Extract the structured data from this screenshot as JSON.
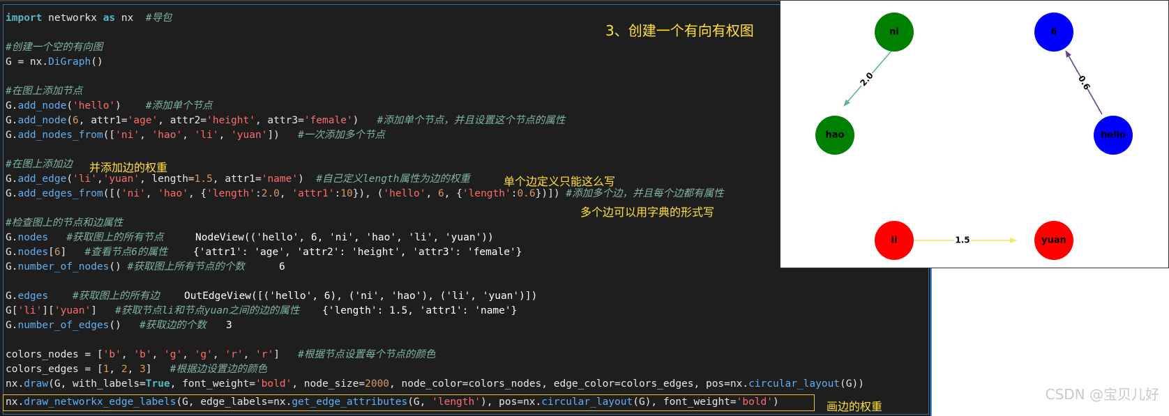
{
  "title_note": "3、创建一个有向有权图",
  "notes": {
    "add_edge_weight": "并添加边的权重",
    "single_edge": "单个边定义只能这么写",
    "multi_edge": "多个边可以用字典的形式写",
    "draw_weight": "画边的权重"
  },
  "code": {
    "l1": [
      "import",
      " networkx ",
      "as",
      " nx  ",
      "#导包"
    ],
    "l3": "#创建一个空的有向图",
    "l4": [
      "G = nx.",
      "DiGraph",
      "()"
    ],
    "l6": "#在图上添加节点",
    "l7": [
      "G.",
      "add_node",
      "(",
      "'hello'",
      ")    ",
      "#添加单个节点"
    ],
    "l8": [
      "G.",
      "add_node",
      "(",
      "6",
      ", attr1=",
      "'age'",
      ", attr2=",
      "'height'",
      ", attr3=",
      "'female'",
      ")   ",
      "#添加单个节点，并且设置这个节点的属性"
    ],
    "l9": [
      "G.",
      "add_nodes_from",
      "([",
      "'ni'",
      ", ",
      "'hao'",
      ", ",
      "'li'",
      ", ",
      "'yuan'",
      "])   ",
      "#一次添加多个节点"
    ],
    "l11": "#在图上添加边",
    "l12": [
      "G.",
      "add_edge",
      "(",
      "'li'",
      ",",
      "'yuan'",
      ", length=",
      "1.5",
      ", attr1=",
      "'name'",
      ")  ",
      "#自己定义length属性为边的权重"
    ],
    "l13": [
      "G.",
      "add_edges_from",
      "([(",
      "'ni'",
      ", ",
      "'hao'",
      ", {",
      "'length'",
      ":",
      "2.0",
      ", ",
      "'attr1'",
      ":",
      "10",
      "}), (",
      "'hello'",
      ", ",
      "6",
      ", {",
      "'length'",
      ":",
      "0.6",
      "})]) ",
      "#添加多个边，并且每个边都有属性"
    ],
    "l15": "#检查图上的节点和边属性",
    "l16": [
      "G.",
      "nodes",
      "   ",
      "#获取图上的所有节点"
    ],
    "l16_out": "NodeView(('hello', 6, 'ni', 'hao', 'li', 'yuan'))",
    "l17": [
      "G.",
      "nodes",
      "[",
      "6",
      "]   ",
      "#查看节点6的属性"
    ],
    "l17_out": "{'attr1': 'age', 'attr2': 'height', 'attr3': 'female'}",
    "l18": [
      "G.",
      "number_of_nodes",
      "() ",
      "#获取图上所有节点的个数"
    ],
    "l18_out": "6",
    "l20": [
      "G.",
      "edges",
      "    ",
      "#获取图上的所有边"
    ],
    "l20_out": "OutEdgeView([('hello', 6), ('ni', 'hao'), ('li', 'yuan')])",
    "l21": [
      "G[",
      "'li'",
      "][",
      "'yuan'",
      "]   ",
      "#获取节点li和节点yuan之间的边的属性"
    ],
    "l21_out": "{'length': 1.5, 'attr1': 'name'}",
    "l22": [
      "G.",
      "number_of_edges",
      "()   ",
      "#获取边的个数"
    ],
    "l22_out": "3",
    "l24": [
      "colors_nodes = [",
      "'b'",
      ", ",
      "'b'",
      ", ",
      "'g'",
      ", ",
      "'g'",
      ", ",
      "'r'",
      ", ",
      "'r'",
      "]   ",
      "#根据节点设置每个节点的颜色"
    ],
    "l25": [
      "colors_edges = [",
      "1",
      ", ",
      "2",
      ", ",
      "3",
      "]   ",
      "#根据边设置边的颜色"
    ],
    "l26": [
      "nx.",
      "draw",
      "(G, with_labels=",
      "True",
      ", font_weight=",
      "'bold'",
      ", node_size=",
      "2000",
      ", node_color=colors_nodes, edge_color=colors_edges, pos=nx.",
      "circular_layout",
      "(G))"
    ],
    "l27": [
      "nx.",
      "draw_networkx_edge_labels",
      "(G, edge_labels=nx.",
      "get_edge_attributes",
      "(G, ",
      "'length'",
      "), pos=nx.",
      "circular_layout",
      "(G), font_weight=",
      "'bold'",
      ")"
    ]
  },
  "graph": {
    "nodes": [
      {
        "label": "ni",
        "color": "#008000"
      },
      {
        "label": "6",
        "color": "#0000ff"
      },
      {
        "label": "hao",
        "color": "#008000"
      },
      {
        "label": "hello",
        "color": "#0000ff"
      },
      {
        "label": "li",
        "color": "#ff0000"
      },
      {
        "label": "yuan",
        "color": "#ff0000"
      }
    ],
    "edges": [
      {
        "from": "ni",
        "to": "hao",
        "label": "2.0",
        "color": "#5fb0a8"
      },
      {
        "from": "hello",
        "to": "6",
        "label": "0.6",
        "color": "#6a3d8a"
      },
      {
        "from": "li",
        "to": "yuan",
        "label": "1.5",
        "color": "#f5e663"
      }
    ]
  },
  "watermark": "CSDN @宝贝儿好"
}
